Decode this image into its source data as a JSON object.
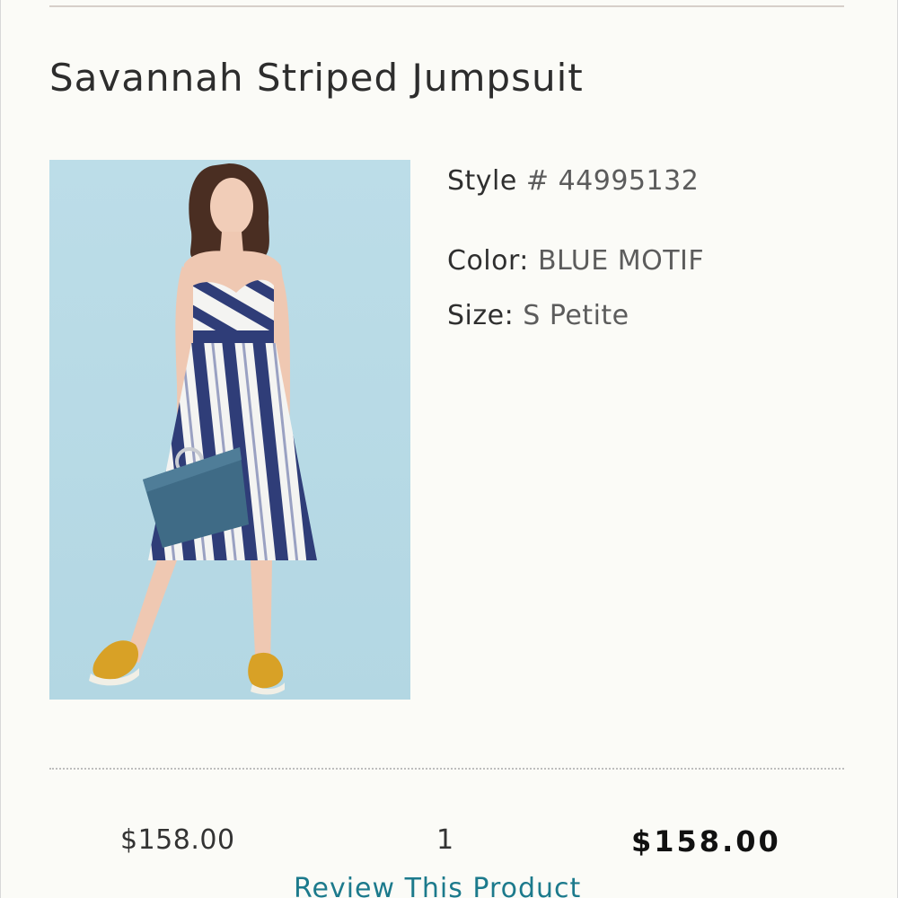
{
  "product": {
    "title": "Savannah Striped Jumpsuit",
    "image_alt": "Model wearing blue and white striped strapless jumpsuit with blue handbag and yellow sneakers"
  },
  "details": {
    "style_label": "Style",
    "style_value": "# 44995132",
    "color_label": "Color:",
    "color_value": "BLUE MOTIF",
    "size_label": "Size:",
    "size_value": "S Petite"
  },
  "pricing": {
    "unit_price": "$158.00",
    "quantity": "1",
    "total_price": "$158.00"
  },
  "links": {
    "review_label": "Review This Product"
  },
  "colors": {
    "background": "#fbfbf7",
    "link": "#1c7a8c",
    "image_backdrop": "#b9dbe6",
    "stripe_navy": "#2f3d78"
  }
}
